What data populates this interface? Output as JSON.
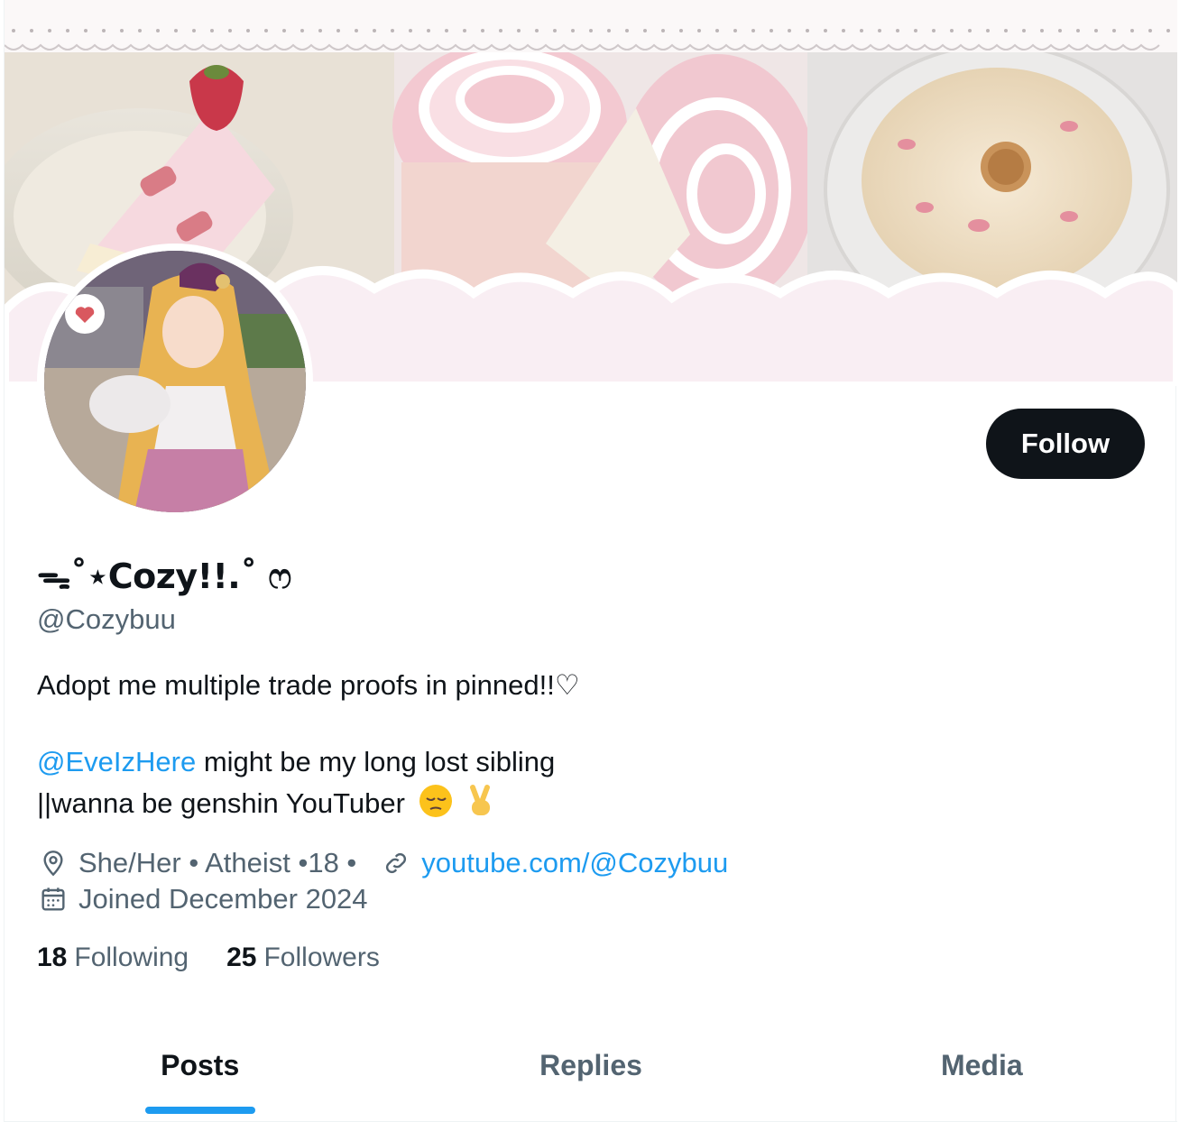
{
  "profile": {
    "display_name": "ᯓ˚⋆Cozy!!.˚ ෆ",
    "handle": "@Cozybuu",
    "follow_label": "Follow"
  },
  "bio": {
    "line1": "Adopt me multiple trade proofs in pinned!!♡",
    "mention": "@EveIzHere",
    "line2_rest": " might be my long lost sibling",
    "line3": "||wanna be genshin YouTuber"
  },
  "meta": {
    "location": "She/Her • Atheist •18 •",
    "website": "youtube.com/@Cozybuu",
    "joined": "Joined December 2024"
  },
  "stats": {
    "following_count": "18",
    "following_label": "Following",
    "followers_count": "25",
    "followers_label": "Followers"
  },
  "tabs": [
    {
      "label": "Posts",
      "active": true
    },
    {
      "label": "Replies",
      "active": false
    },
    {
      "label": "Media",
      "active": false
    }
  ],
  "colors": {
    "accent": "#1d9bf0",
    "text_primary": "#0f1419",
    "text_secondary": "#536471",
    "banner_pink": "#f9eef3"
  },
  "icons": [
    "location-pin-icon",
    "link-icon",
    "calendar-icon",
    "pensive-face-emoji",
    "victory-hand-emoji",
    "heart-badge-icon"
  ]
}
